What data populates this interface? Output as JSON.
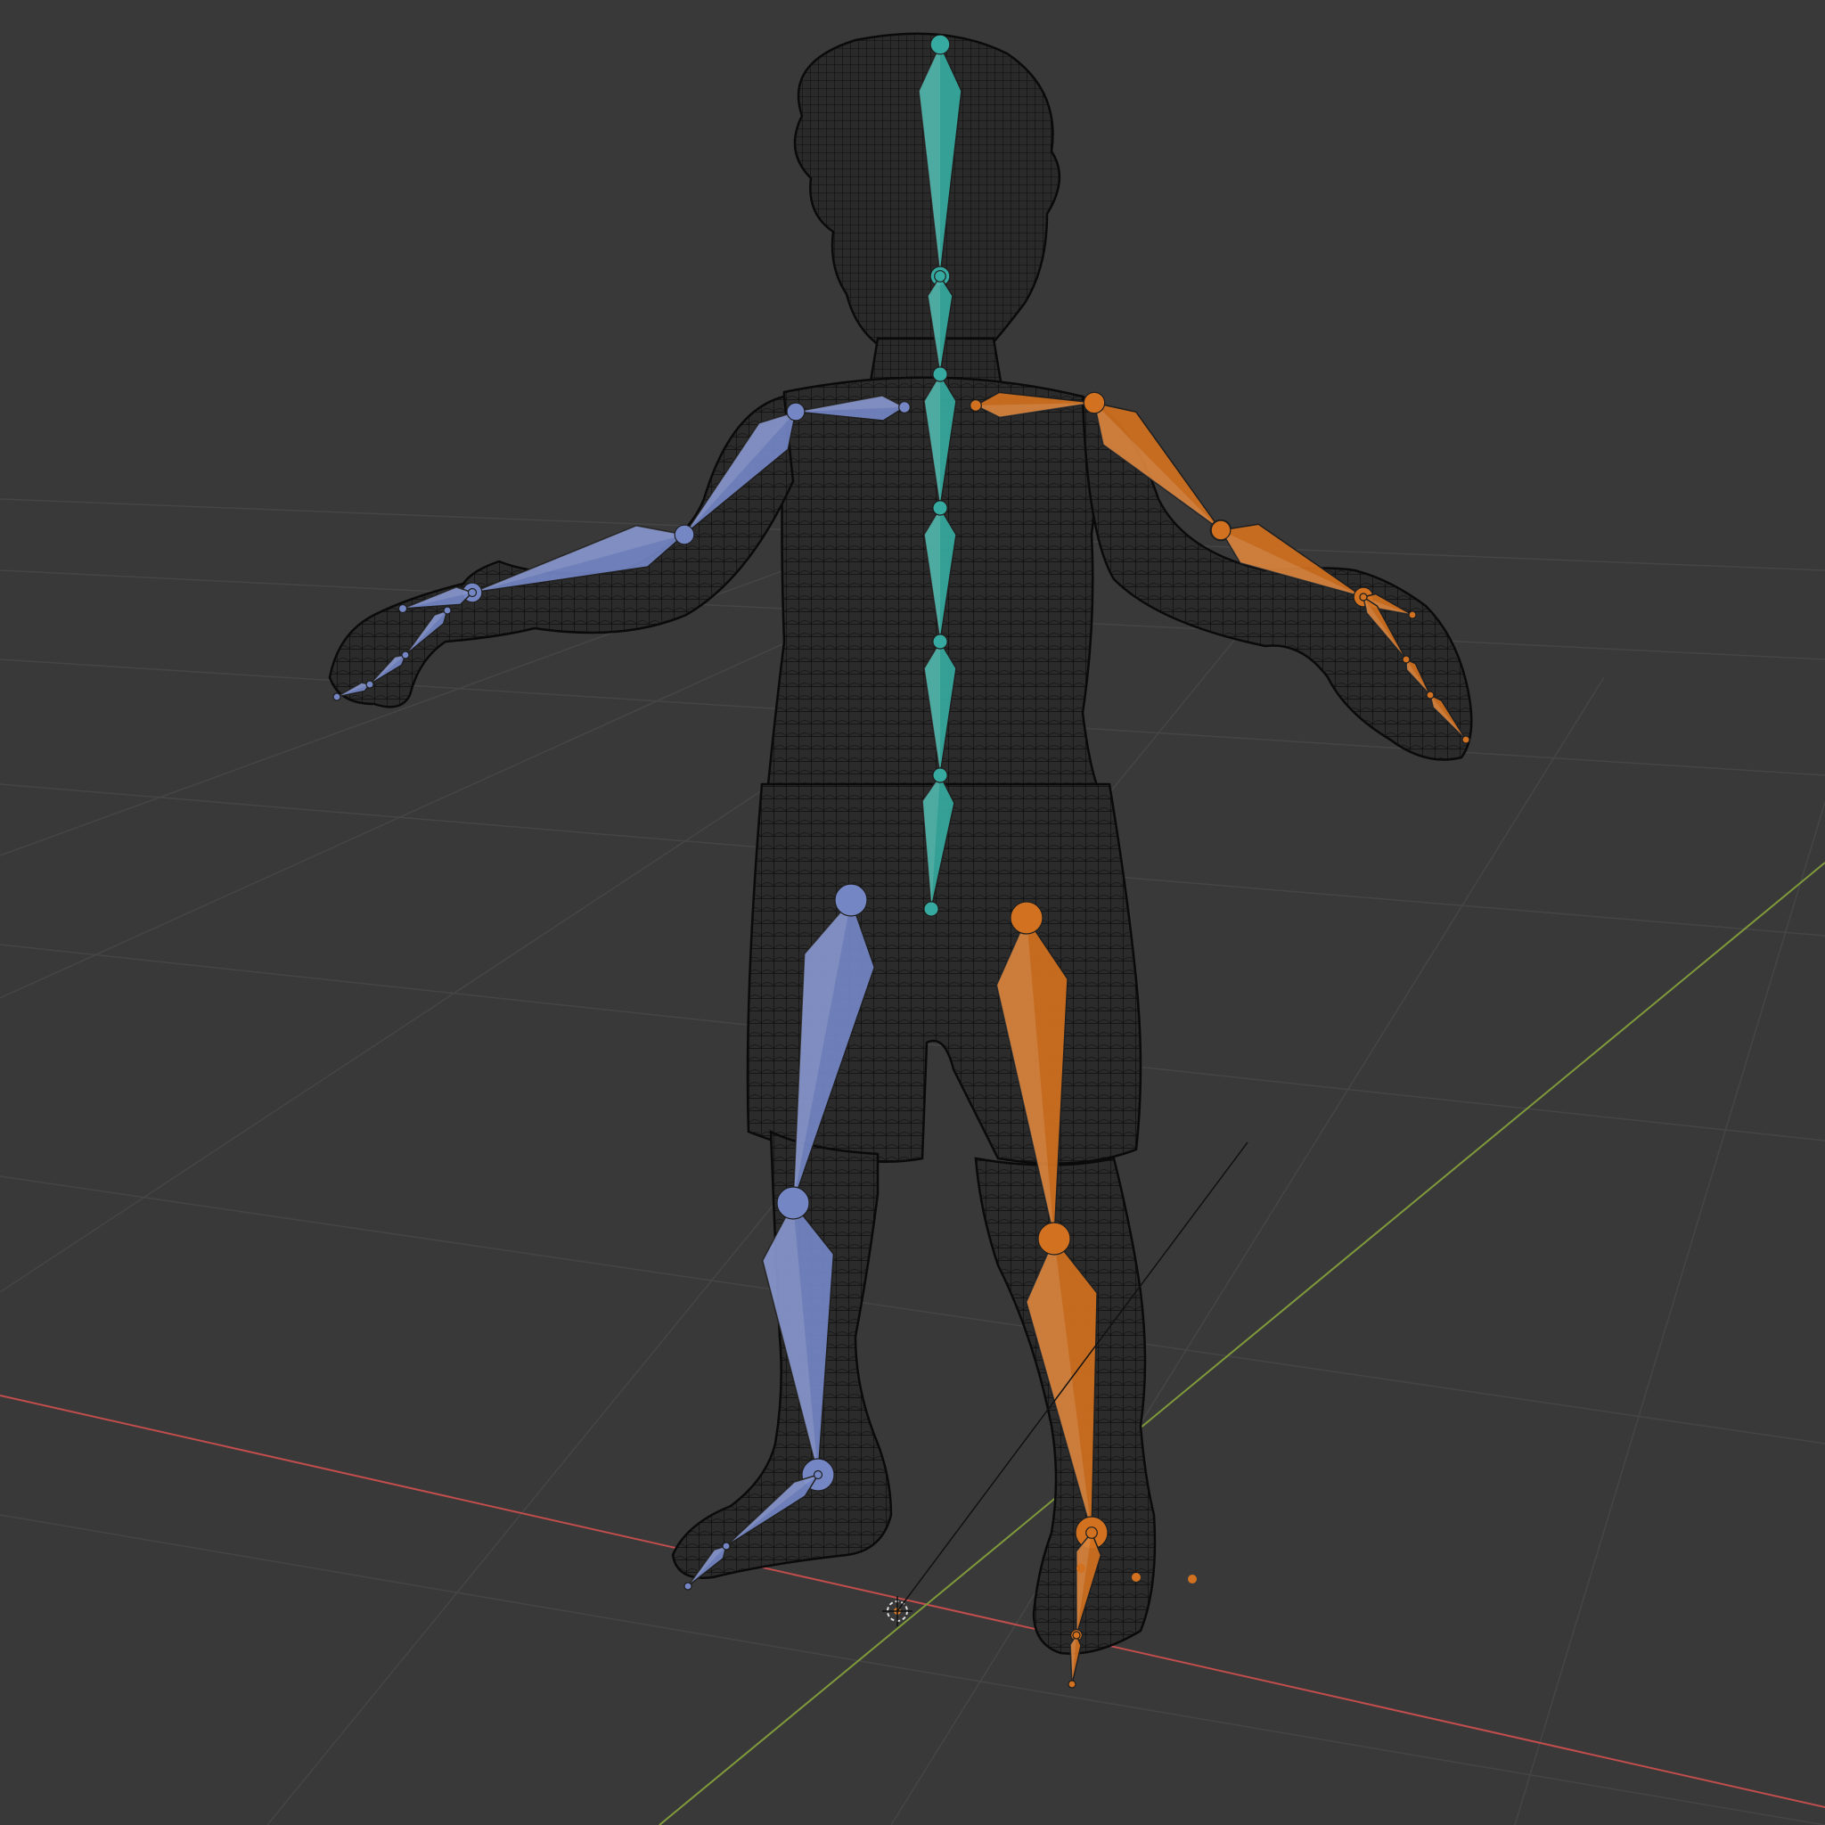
{
  "viewport": {
    "editor": "3D Viewport",
    "shading": "wireframe",
    "object_mode": "pose"
  },
  "colors": {
    "background": "#393939",
    "grid_line": "#454545",
    "axis_x": "#c24d4d",
    "axis_y": "#7f9a3a",
    "mesh_wire": "#0d0d0d",
    "mesh_fill": "#2b2b2b",
    "bone_center": "#36aaa0",
    "bone_left": "#7486c4",
    "bone_right": "#d2711f",
    "bone_outline_dark": "#1f1f1f"
  },
  "armature": {
    "center_group": "spine",
    "left_group": "left",
    "right_group": "right"
  }
}
